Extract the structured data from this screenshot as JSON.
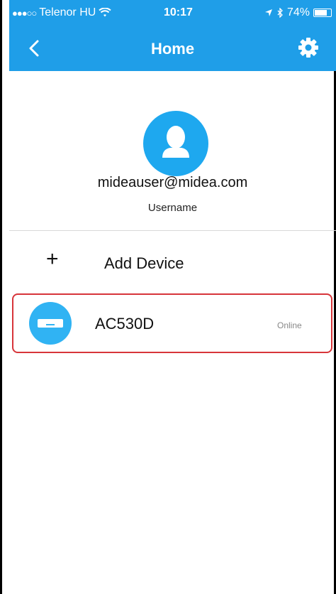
{
  "status_bar": {
    "signal_dots": "●●●○○",
    "carrier": "Telenor HU",
    "wifi_icon": "wifi-icon",
    "time": "10:17",
    "location_icon": "location-arrow-icon",
    "bluetooth_icon": "bluetooth-icon",
    "battery": "74%"
  },
  "header": {
    "title": "Home",
    "back_icon": "chevron-left-icon",
    "settings_icon": "gear-icon"
  },
  "profile": {
    "avatar_icon": "user-icon",
    "email": "mideauser@midea.com",
    "label": "Username"
  },
  "add_device": {
    "icon": "plus-icon",
    "label": "Add Device"
  },
  "devices": [
    {
      "name": "AC530D",
      "status": "Online",
      "icon": "air-conditioner-icon"
    }
  ],
  "colors": {
    "header_bg": "#1f9ee8",
    "accent": "#1ea8ef",
    "highlight_border": "#d7353a"
  }
}
